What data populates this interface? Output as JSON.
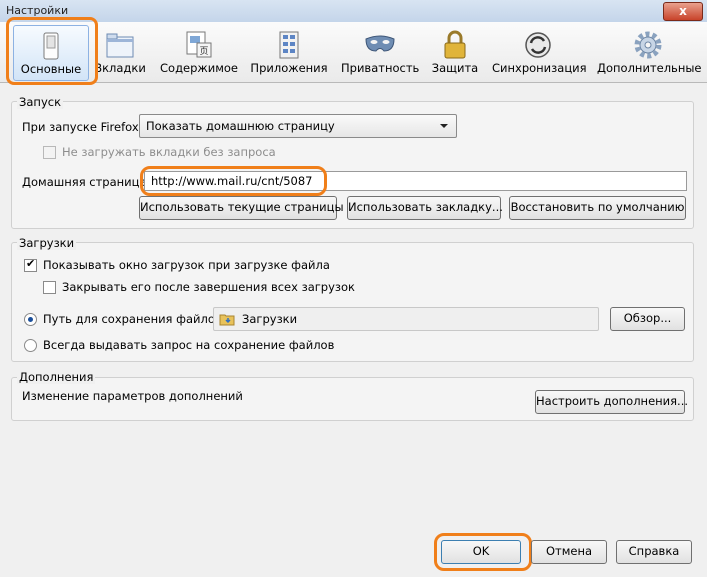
{
  "window": {
    "title": "Настройки",
    "close_label": "x"
  },
  "tabs": [
    {
      "label": "Основные",
      "icon": "switch-icon",
      "selected": true
    },
    {
      "label": "Вкладки",
      "icon": "tabs-icon"
    },
    {
      "label": "Содержимое",
      "icon": "content-icon"
    },
    {
      "label": "Приложения",
      "icon": "applications-icon"
    },
    {
      "label": "Приватность",
      "icon": "mask-icon"
    },
    {
      "label": "Защита",
      "icon": "lock-icon"
    },
    {
      "label": "Синхронизация",
      "icon": "sync-icon"
    },
    {
      "label": "Дополнительные",
      "icon": "gear-icon"
    }
  ],
  "startup": {
    "group_label": "Запуск",
    "on_start_label": "При запуске Firefox:",
    "on_start_value": "Показать домашнюю страницу",
    "no_load_tabs_label": "Не загружать вкладки без запроса",
    "homepage_label": "Домашняя страница:",
    "homepage_value": "http://www.mail.ru/cnt/5087",
    "use_current_label": "Использовать текущие страницы",
    "use_bookmark_label": "Использовать закладку...",
    "restore_default_label": "Восстановить по умолчанию"
  },
  "downloads": {
    "group_label": "Загрузки",
    "show_window_label": "Показывать окно загрузок при загрузке файла",
    "show_window_checked": true,
    "close_after_label": "Закрывать его после завершения всех загрузок",
    "close_after_checked": false,
    "save_path_label": "Путь для сохранения файлов",
    "save_path_value": "Загрузки",
    "browse_label": "Обзор...",
    "always_ask_label": "Всегда выдавать запрос на сохранение файлов"
  },
  "addons": {
    "group_label": "Дополнения",
    "desc": "Изменение параметров дополнений",
    "manage_label": "Настроить дополнения..."
  },
  "footer": {
    "ok_label": "OK",
    "cancel_label": "Отмена",
    "help_label": "Справка"
  },
  "colors": {
    "highlight": "#f07f1a",
    "selected_tab": "#d2e4f7"
  }
}
